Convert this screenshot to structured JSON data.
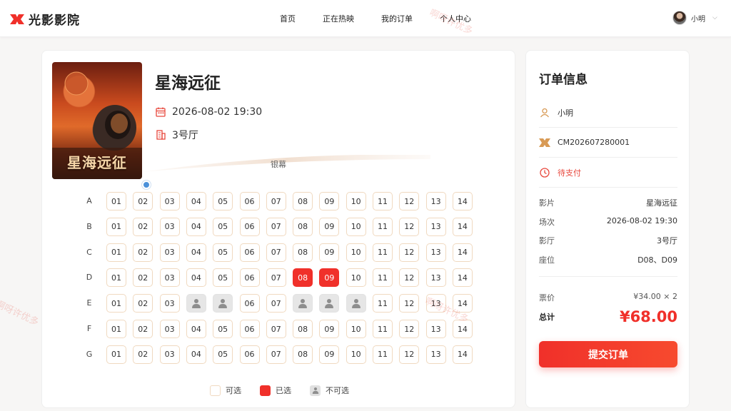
{
  "brand": {
    "name": "光影影院",
    "accent": "#f0302a"
  },
  "nav": {
    "items": [
      "首页",
      "正在热映",
      "我的订单",
      "个人中心"
    ]
  },
  "user": {
    "name": "小明"
  },
  "movie": {
    "title": "星海远征",
    "poster_title": "星海远征",
    "datetime": "2026-08-02 19:30",
    "hall": "3号厅"
  },
  "screen": {
    "label": "银幕"
  },
  "seats": {
    "rows": [
      "A",
      "B",
      "C",
      "D",
      "E",
      "F",
      "G"
    ],
    "numbers": [
      "01",
      "02",
      "03",
      "04",
      "05",
      "06",
      "07",
      "08",
      "09",
      "10",
      "11",
      "12",
      "13",
      "14"
    ],
    "selected": [
      "D08",
      "D09"
    ],
    "taken": [
      "E04",
      "E05",
      "E08",
      "E09",
      "E10"
    ]
  },
  "legend": {
    "available": "可选",
    "selected": "已选",
    "taken": "不可选"
  },
  "order": {
    "title": "订单信息",
    "user": "小明",
    "order_no": "CM202607280001",
    "status": "待支付",
    "details": [
      {
        "key": "影片",
        "value": "星海远征"
      },
      {
        "key": "场次",
        "value": "2026-08-02 19:30"
      },
      {
        "key": "影厅",
        "value": "3号厅"
      },
      {
        "key": "座位",
        "value": "D08、D09"
      }
    ],
    "price_label": "票价",
    "price_value": "¥34.00 × 2",
    "total_label": "总计",
    "total_value": "¥68.00",
    "submit_label": "提交订单"
  },
  "watermark": "啊呀许优多"
}
